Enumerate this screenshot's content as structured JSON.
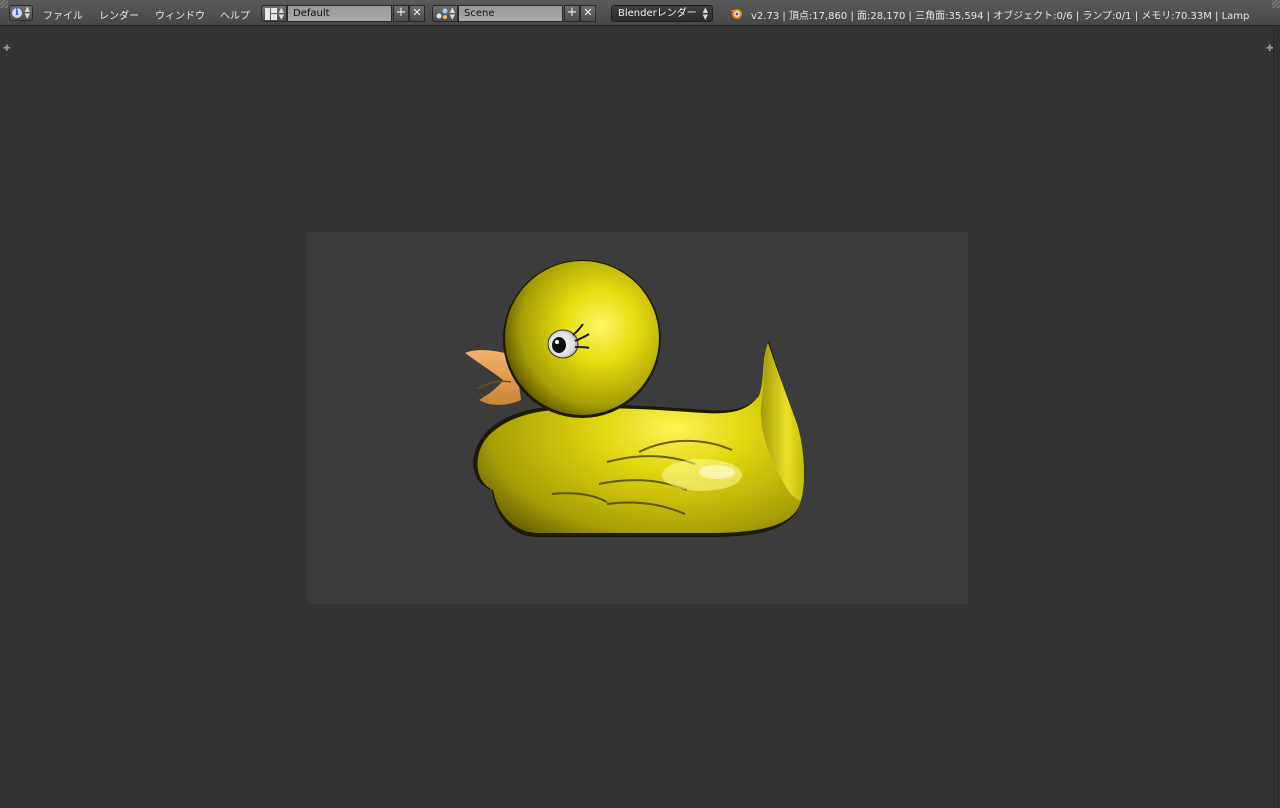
{
  "menu": {
    "file": "ファイル",
    "render": "レンダー",
    "window": "ウィンドウ",
    "help": "ヘルプ"
  },
  "layout": {
    "value": "Default"
  },
  "scene": {
    "value": "Scene"
  },
  "render_engine": {
    "value": "Blenderレンダー"
  },
  "stats": {
    "text": "v2.73 | 頂点:17,860 | 面:28,170 | 三角面:35,594 | オブジェクト:0/6 | ランプ:0/1 | メモリ:70.33M | Lamp"
  },
  "icons": {
    "editor_type": "info-icon",
    "layout": "screen-layout-icon",
    "scene": "scene-icon",
    "add": "plus-icon",
    "remove": "x-icon",
    "logo": "blender-logo-icon"
  },
  "colors": {
    "duck_yellow": "#e5dc12",
    "beak": "#e8a65a",
    "viewport_bg": "#343434",
    "render_bg": "#3c3c3c"
  }
}
